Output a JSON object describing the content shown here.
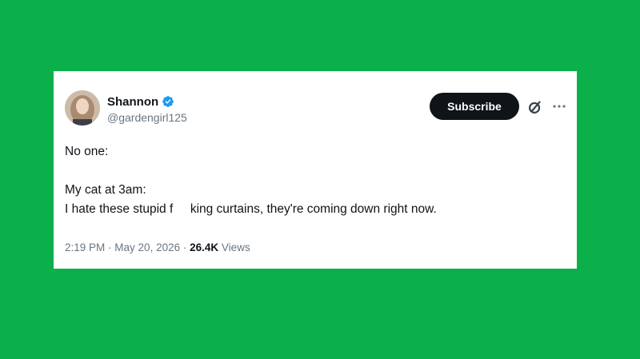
{
  "tweet": {
    "author": {
      "display_name": "Shannon",
      "handle": "@gardengirl125",
      "verified": true,
      "verified_color": "#1d9bf0"
    },
    "subscribe_label": "Subscribe",
    "text_lines": [
      "No one:",
      "",
      "My cat at 3am:",
      "I hate these stupid f     king curtains, they're coming down right now."
    ],
    "time": "2:19 PM",
    "date": "May 20, 2026",
    "views_count": "26.4K",
    "views_label": "Views"
  },
  "colors": {
    "background": "#0bb04a",
    "card": "#ffffff",
    "text": "#0f1419",
    "muted": "#6b7680"
  },
  "icons": [
    "verified-badge-icon",
    "grok-icon",
    "more-icon"
  ]
}
